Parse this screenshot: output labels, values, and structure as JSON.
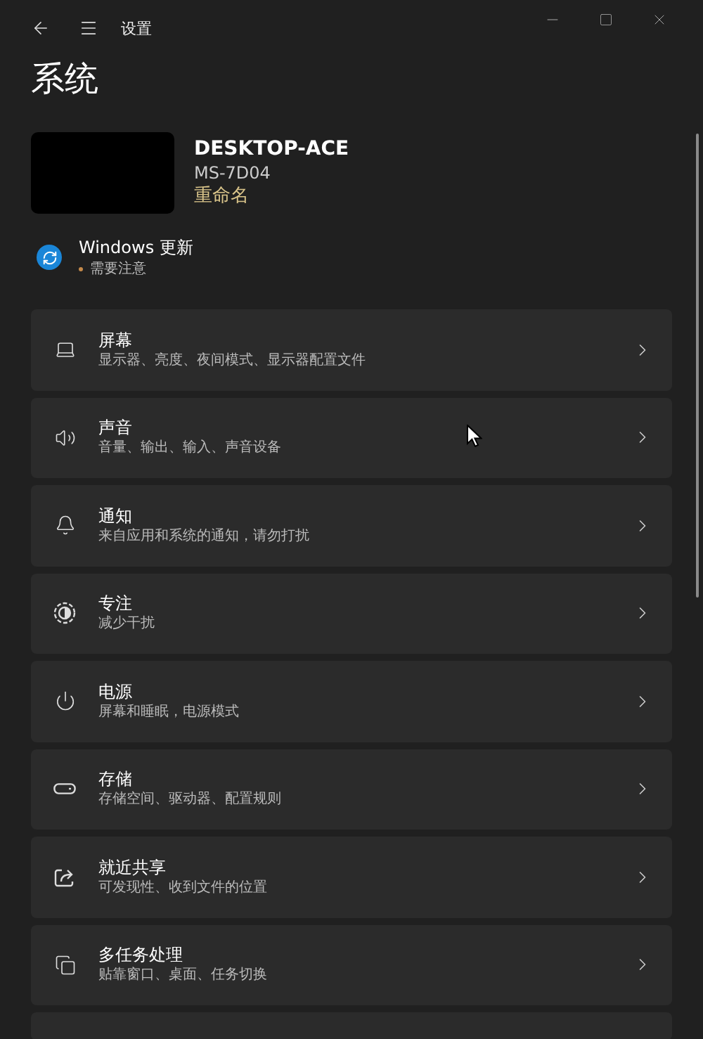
{
  "window": {
    "title": "设置"
  },
  "page_title": "系统",
  "device": {
    "name": "DESKTOP-ACE",
    "model": "MS-7D04",
    "rename_link": "重命名"
  },
  "update": {
    "title": "Windows 更新",
    "status": "需要注意"
  },
  "items": [
    {
      "kind": "display",
      "title": "屏幕",
      "subtitle": "显示器、亮度、夜间模式、显示器配置文件"
    },
    {
      "kind": "sound",
      "title": "声音",
      "subtitle": "音量、输出、输入、声音设备"
    },
    {
      "kind": "bell",
      "title": "通知",
      "subtitle": "来自应用和系统的通知，请勿打扰"
    },
    {
      "kind": "focus",
      "title": "专注",
      "subtitle": "减少干扰"
    },
    {
      "kind": "power",
      "title": "电源",
      "subtitle": "屏幕和睡眠，电源模式"
    },
    {
      "kind": "storage",
      "title": "存储",
      "subtitle": "存储空间、驱动器、配置规则"
    },
    {
      "kind": "share",
      "title": "就近共享",
      "subtitle": "可发现性、收到文件的位置"
    },
    {
      "kind": "multitask",
      "title": "多任务处理",
      "subtitle": "贴靠窗口、桌面、任务切换"
    }
  ]
}
